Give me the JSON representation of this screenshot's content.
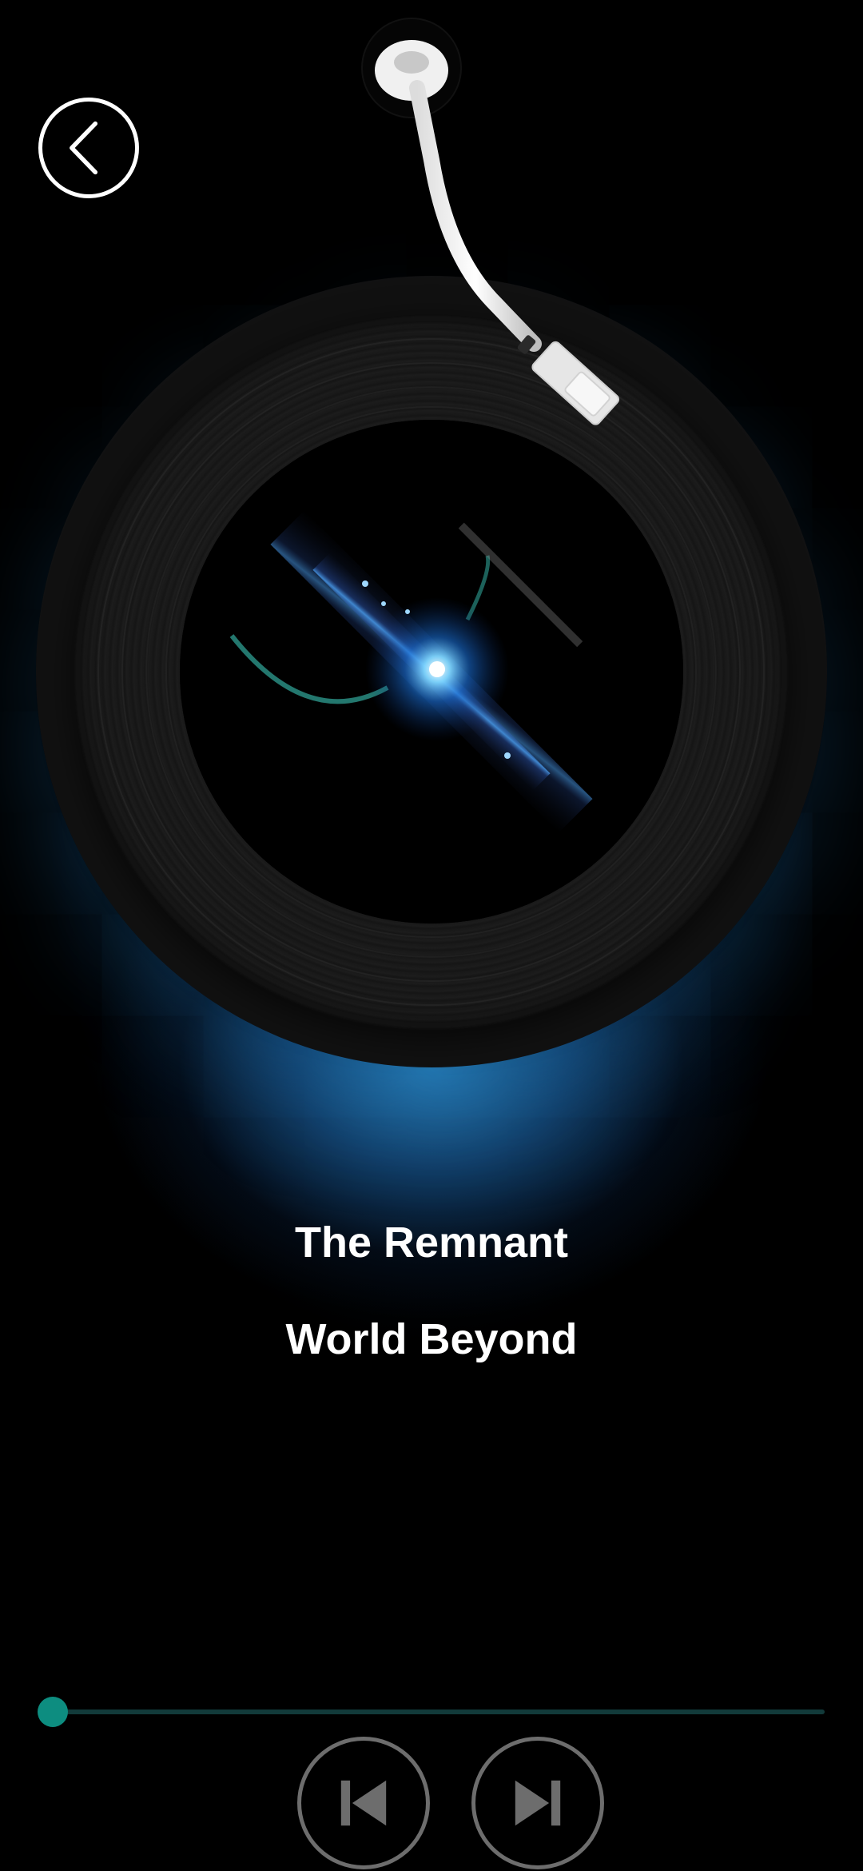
{
  "track": {
    "title": "The Remnant",
    "artist": "World Beyond"
  },
  "player": {
    "progress_fraction": 0.018
  },
  "icons": {
    "back": "chevron-left-icon",
    "previous": "skip-previous-icon",
    "next": "skip-next-icon"
  },
  "colors": {
    "accent": "#0d8d80",
    "track_background": "#123a3a",
    "glow": "#2882be",
    "control_border": "#6d6d6d"
  }
}
